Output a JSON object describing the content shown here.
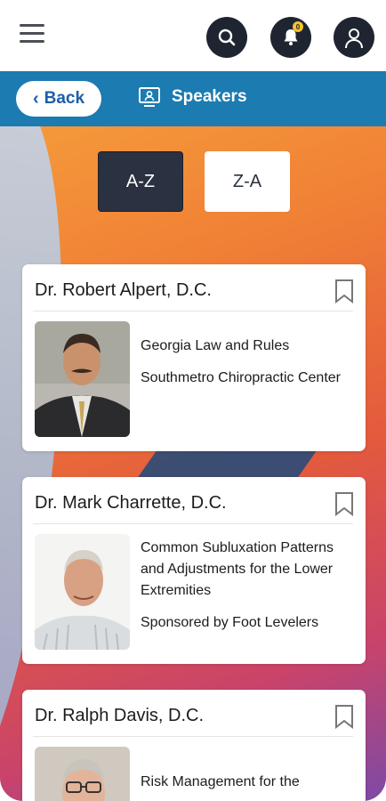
{
  "topbar": {
    "menu_icon": "hamburger-menu-icon",
    "search_icon": "search-icon",
    "notifications_icon": "bell-icon",
    "notifications_badge": "0",
    "profile_icon": "user-icon"
  },
  "header": {
    "back_label": "Back",
    "title": "Speakers",
    "title_icon": "presenter-icon",
    "color": "#1c7bb0"
  },
  "sort": {
    "az_label": "A-Z",
    "za_label": "Z-A",
    "selected": "A-Z"
  },
  "speakers": [
    {
      "name": "Dr. Robert Alpert, D.C.",
      "session": "Georgia Law and Rules",
      "detail": "Southmetro Chiropractic Center"
    },
    {
      "name": "Dr. Mark Charrette, D.C.",
      "session": "Common Subluxation Patterns and Adjustments for the Lower Extremities",
      "detail": "Sponsored by Foot Levelers"
    },
    {
      "name": "Dr. Ralph Davis, D.C.",
      "session": "Risk Management for the",
      "detail": ""
    }
  ]
}
